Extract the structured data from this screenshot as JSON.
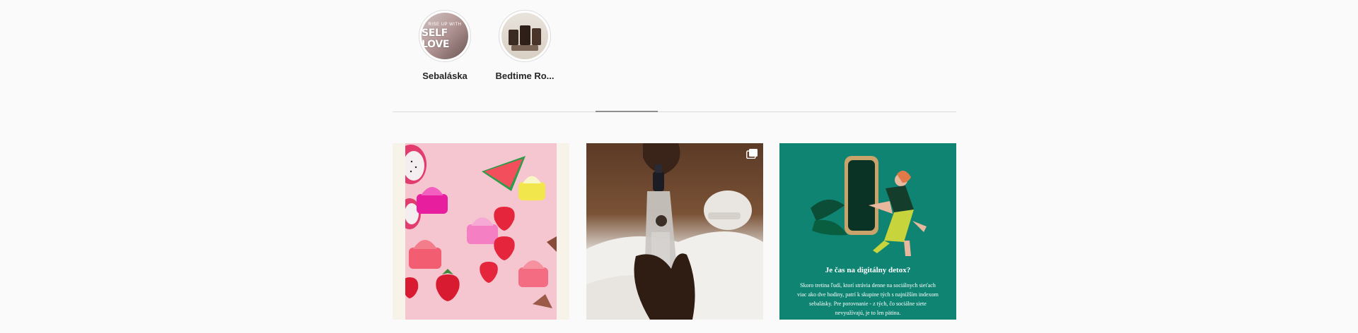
{
  "highlights": [
    {
      "label": "Sebaláska",
      "thumb_text_small": "RISE UP WITH",
      "thumb_text_big": "SELF LOVE"
    },
    {
      "label": "Bedtime Ro..."
    }
  ],
  "posts": [
    {
      "kind": "image",
      "subject": "pink lip balms with strawberries and watermelon"
    },
    {
      "kind": "carousel",
      "subject": "hand holding a spray bottle",
      "icon": "multiple-images-icon"
    },
    {
      "kind": "image",
      "title": "Je čas na digitálny detox?",
      "body": "Skoro tretina ľudí, ktorí strávia denne na sociálnych sieťach viac ako dve hodiny, patrí k skupine tých s najnižším indexom sebalásky. Pre porovnanie - z tých, čo sociálne siete nevyužívajú, je to len pätina."
    }
  ],
  "colors": {
    "background": "#fafafa",
    "divider": "#dbdbdb",
    "active_tab": "#8e8e8e",
    "teal": "#0f8472"
  }
}
